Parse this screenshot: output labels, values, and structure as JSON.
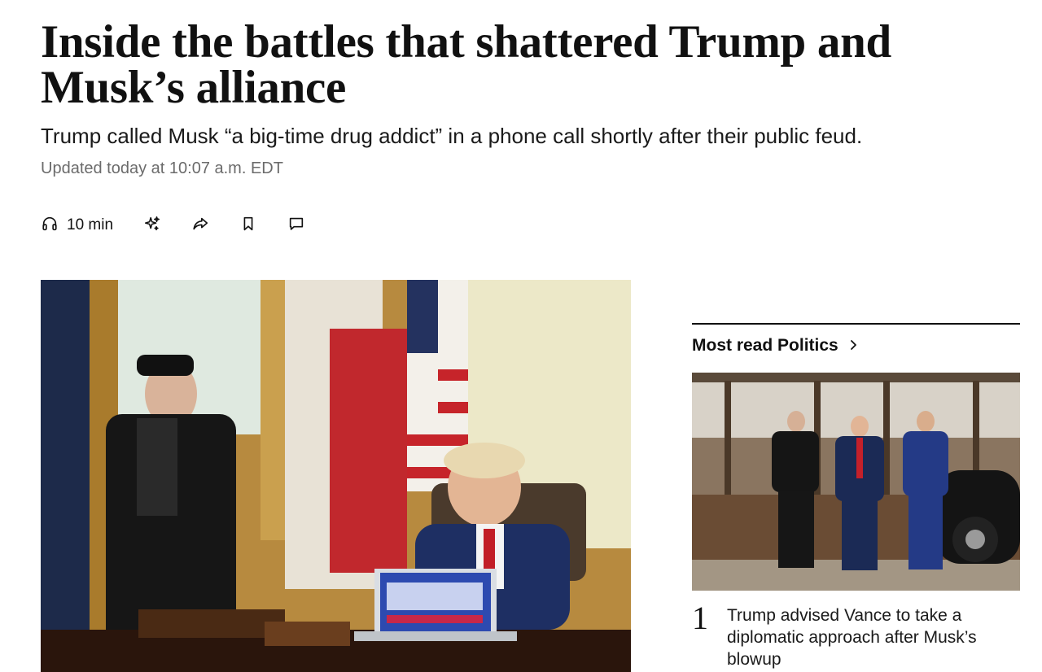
{
  "article": {
    "headline": "Inside the battles that shattered Trump and Musk’s alliance",
    "dek": "Trump called Musk “a big-time drug addict” in a phone call shortly after their public feud.",
    "updated": "Updated today at 10:07 a.m. EDT"
  },
  "toolbar": {
    "listen_label": "10 min",
    "icons": [
      "headphones-icon",
      "sparkle-icon",
      "share-icon",
      "bookmark-icon",
      "comment-icon"
    ]
  },
  "sidebar": {
    "heading": "Most read Politics",
    "stories": [
      {
        "rank": "1",
        "title": "Trump advised Vance to take a diplomatic approach after Musk’s blowup"
      }
    ]
  },
  "colors": {
    "text": "#111111",
    "muted": "#6b6b6b",
    "background": "#ffffff"
  }
}
